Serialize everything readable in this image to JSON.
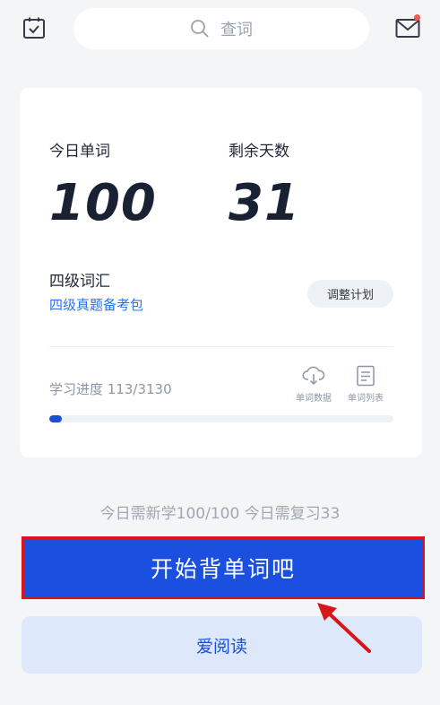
{
  "header": {
    "calendar_icon": "calendar-check-icon",
    "search_placeholder": "查词",
    "mail_icon": "mail-icon",
    "notification_dot_color": "#f05a4f"
  },
  "plan_card": {
    "today_words_label": "今日单词",
    "today_words_value": "100",
    "remaining_days_label": "剩余天数",
    "remaining_days_value": "31",
    "book_title": "四级词汇",
    "book_subtitle": "四级真题备考包",
    "adjust_button": "调整计划",
    "progress_text": "学习进度 113/3130",
    "progress_fraction": 0.036,
    "tools": [
      {
        "label": "单词数据",
        "icon": "cloud-download-icon"
      },
      {
        "label": "单词列表",
        "icon": "list-document-icon"
      }
    ]
  },
  "today_summary": "今日需新学100/100  今日需复习33",
  "start_button": "开始背单词吧",
  "read_button": "爱阅读",
  "colors": {
    "accent": "#1a4fe0",
    "link": "#2a73e8",
    "highlight_border": "#d8151b",
    "read_button_bg": "#dde8fb"
  }
}
